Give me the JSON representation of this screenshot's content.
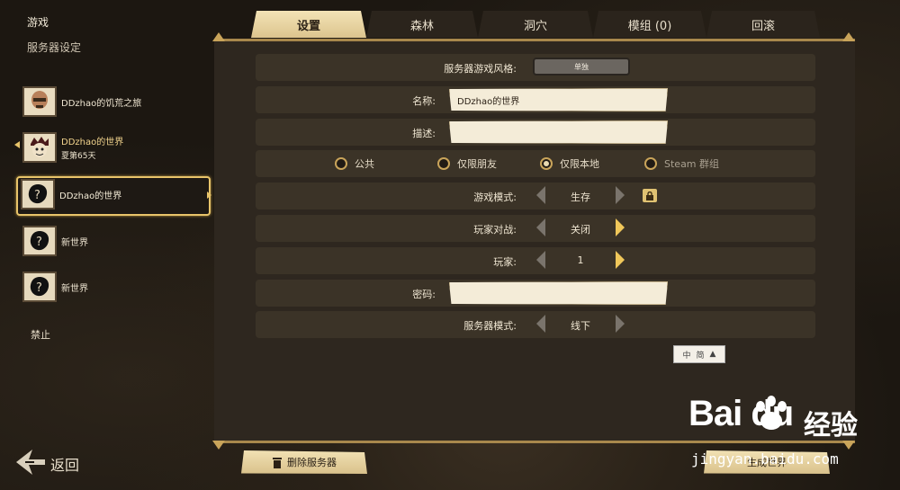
{
  "sidebar": {
    "title": "游戏",
    "subtitle": "服务器设定",
    "slots": [
      {
        "name": "DDzhao的饥荒之旅",
        "day": ""
      },
      {
        "name": "DDzhao的世界",
        "day": "夏第65天"
      },
      {
        "name": "DDzhao的世界",
        "day": ""
      },
      {
        "name": "新世界",
        "day": ""
      },
      {
        "name": "新世界",
        "day": ""
      }
    ],
    "disable": "禁止",
    "back": "返回"
  },
  "tabs": [
    {
      "label": "设置"
    },
    {
      "label": "森林"
    },
    {
      "label": "洞穴"
    },
    {
      "label": "模组 (0)"
    },
    {
      "label": "回滚"
    }
  ],
  "settings": {
    "style_label": "服务器游戏风格:",
    "style_value": "单独",
    "name_label": "名称:",
    "name_value": "DDzhao的世界",
    "desc_label": "描述:",
    "desc_value": "",
    "privacy_options": [
      {
        "label": "公共",
        "selected": false
      },
      {
        "label": "仅限朋友",
        "selected": false
      },
      {
        "label": "仅限本地",
        "selected": true
      },
      {
        "label": "Steam 群组",
        "selected": false
      }
    ],
    "game_mode_label": "游戏模式:",
    "game_mode_value": "生存",
    "pvp_label": "玩家对战:",
    "pvp_value": "关闭",
    "players_label": "玩家:",
    "players_value": "1",
    "password_label": "密码:",
    "password_value": "",
    "server_mode_label": "服务器模式:",
    "server_mode_value": "线下"
  },
  "ime": {
    "a": "中",
    "b": "简"
  },
  "buttons": {
    "delete": "删除服务器",
    "generate": "生成世界"
  },
  "watermark": {
    "logo": "Bai du",
    "cn": "经验",
    "url": "jingyan.baidu.com"
  },
  "colors": {
    "gold": "#e8c46a",
    "panel": "#2e271f",
    "row": "#3b3327",
    "tab_active": "#f3e3b6"
  }
}
